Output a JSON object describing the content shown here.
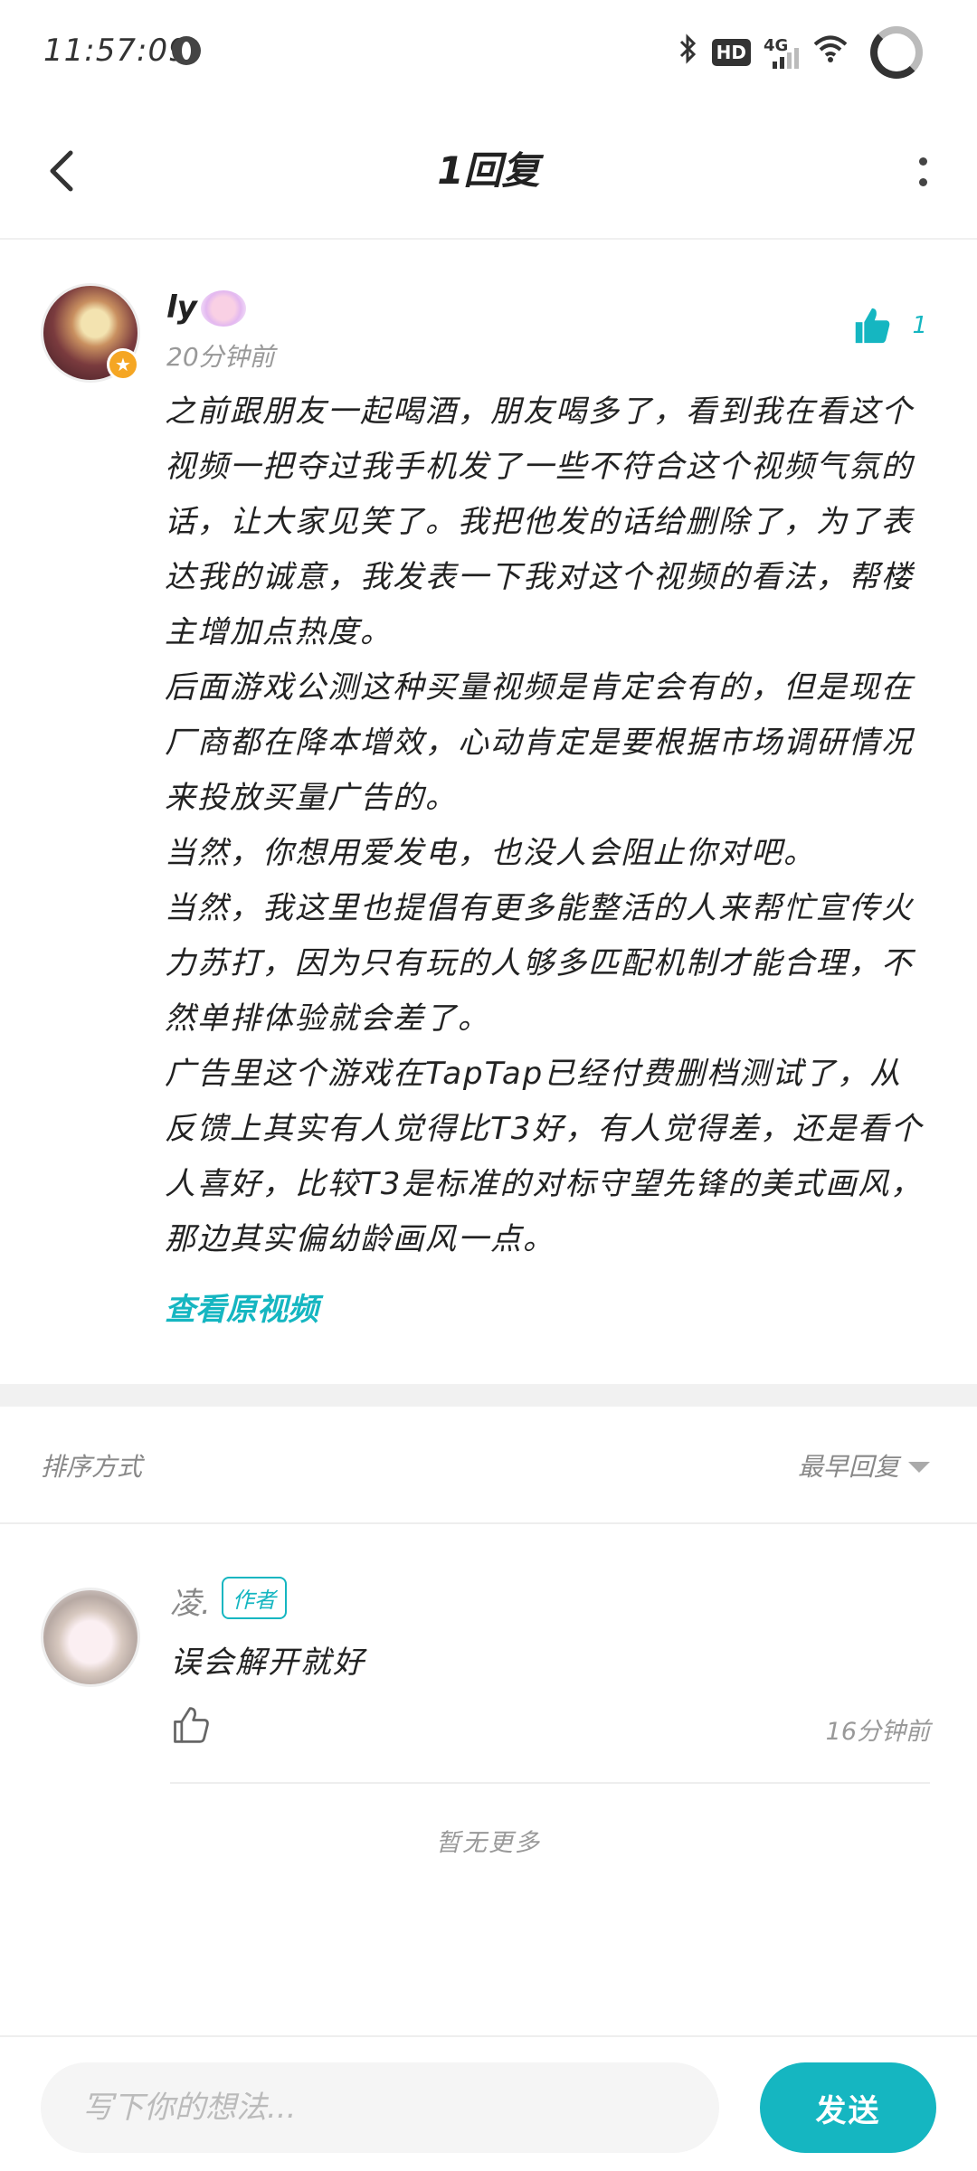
{
  "status_bar": {
    "time": "11:57:09",
    "hd_label": "HD",
    "network_label": "4G",
    "icons": [
      "globe-icon",
      "bluetooth-icon",
      "hd-icon",
      "signal-icon",
      "wifi-icon",
      "battery-ring-icon"
    ]
  },
  "header": {
    "title": "1回复",
    "back_icon": "chevron-left-icon",
    "more_icon": "more-vertical-icon"
  },
  "main_comment": {
    "username": "ly",
    "time": "20分钟前",
    "like_count": "1",
    "paragraphs": [
      "之前跟朋友一起喝酒，朋友喝多了，看到我在看这个视频一把夺过我手机发了一些不符合这个视频气氛的话，让大家见笑了。我把他发的话给删除了，为了表达我的诚意，我发表一下我对这个视频的看法，帮楼主增加点热度。",
      "后面游戏公测这种买量视频是肯定会有的，但是现在厂商都在降本增效，心动肯定是要根据市场调研情况来投放买量广告的。",
      "当然，你想用爱发电，也没人会阻止你对吧。",
      "当然，我这里也提倡有更多能整活的人来帮忙宣传火力苏打，因为只有玩的人够多匹配机制才能合理，不然单排体验就会差了。",
      "广告里这个游戏在TapTap已经付费删档测试了，从反馈上其实有人觉得比T3好，有人觉得差，还是看个人喜好，比较T3是标准的对标守望先锋的美式画风，那边其实偏幼龄画风一点。"
    ],
    "view_original": "查看原视频"
  },
  "sort": {
    "label": "排序方式",
    "selected": "最早回复"
  },
  "reply": {
    "username": "凌.",
    "author_tag": "作者",
    "text": "误会解开就好",
    "time": "16分钟前"
  },
  "no_more": "暂无更多",
  "input": {
    "placeholder": "写下你的想法...",
    "send_label": "发送"
  },
  "colors": {
    "accent": "#15b6c1",
    "badge": "#f5a623",
    "muted_text": "#999999",
    "divider": "#eeeeee"
  }
}
